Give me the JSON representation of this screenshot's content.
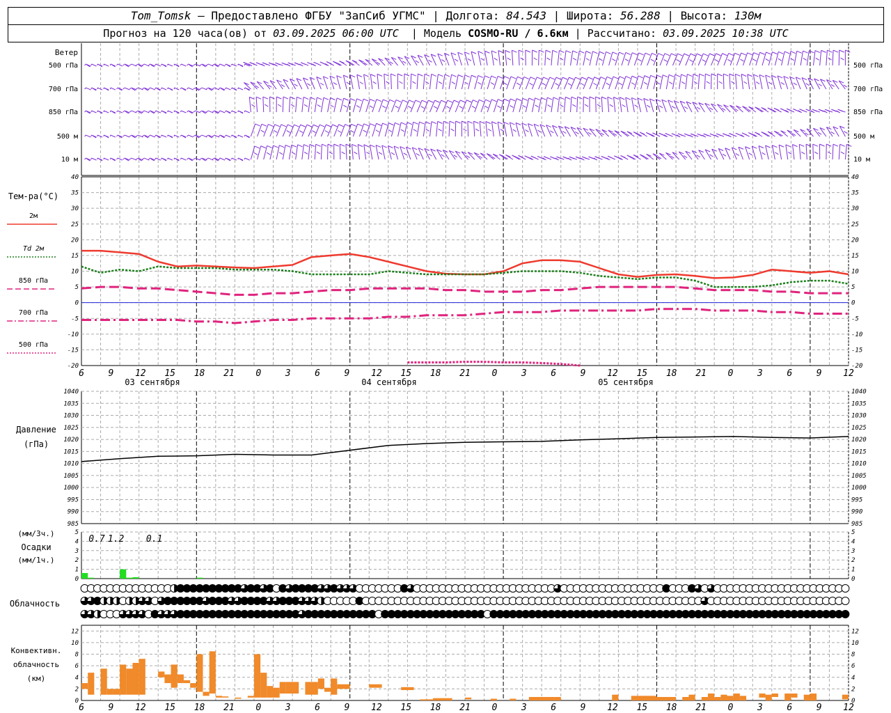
{
  "header": {
    "station": "Tom_Tomsk",
    "provider": "– Предоставлено ФГБУ \"ЗапСиб УГМС\"",
    "lon_label": "Долгота:",
    "lon_value": "84.543",
    "lat_label": "Широта:",
    "lat_value": "56.288",
    "alt_label": "Высота:",
    "alt_value": "130м",
    "forecast_label": "Прогноз на 120 часа(ов) от",
    "forecast_time": "03.09.2025 06:00 UTC",
    "model_label": "Модель",
    "model_value": "COSMO-RU / 6.6км",
    "calc_label": "Рассчитано:",
    "calc_time": "03.09.2025 10:38 UTC"
  },
  "panels": {
    "wind": {
      "title": "Ветер",
      "levels": [
        "500 гПа",
        "700 гПа",
        "850 гПа",
        "500 м",
        "10 м"
      ],
      "barb_color": "#7f2fd8"
    },
    "temp": {
      "title": "Тем-ра(°C)",
      "legend": [
        {
          "label": "2м",
          "color": "#ef3a2e",
          "style": "solid"
        },
        {
          "label": "Td  2м",
          "color": "#1b7f1b",
          "style": "dotted"
        },
        {
          "label": "850 гПа",
          "color": "#e0237e",
          "style": "dashed"
        },
        {
          "label": "700 гПа",
          "color": "#e0237e",
          "style": "dashdot"
        },
        {
          "label": "500 гПа",
          "color": "#e0237e",
          "style": "dotted"
        }
      ],
      "y_ticks": [
        40,
        35,
        30,
        25,
        20,
        15,
        10,
        5,
        0,
        -5,
        -10,
        -15,
        -20
      ],
      "zero_line_color": "#2222dd"
    },
    "pressure": {
      "title": "Давление",
      "unit": "(гПа)",
      "y_ticks": [
        1040,
        1035,
        1030,
        1025,
        1020,
        1015,
        1010,
        1005,
        1000,
        995,
        990,
        985
      ]
    },
    "precip": {
      "unit_3h": "(мм/3ч.)",
      "title": "Осадки",
      "unit_1h": "(мм/1ч.)",
      "y_ticks": [
        5,
        4,
        3,
        2,
        1,
        0
      ],
      "totals": [
        {
          "hour": 6,
          "text": "0.7"
        },
        {
          "hour": 9,
          "text": "1.2"
        },
        {
          "hour": 15,
          "text": "0.1"
        }
      ],
      "bar_color": "#22dd22"
    },
    "cloud": {
      "title": "Облачность"
    },
    "conv": {
      "title": "Конвективн.",
      "title2": "облачность",
      "unit": "(км)",
      "y_ticks": [
        12,
        10,
        8,
        6,
        4,
        2,
        0
      ],
      "bar_color": "#f08a2a"
    }
  },
  "time_axis": {
    "hour_labels": [
      "6",
      "9",
      "12",
      "15",
      "18",
      "21",
      "0",
      "3",
      "6",
      "9",
      "12",
      "15",
      "18",
      "21",
      "0",
      "3",
      "6",
      "9",
      "12",
      "15",
      "18",
      "21",
      "0",
      "3",
      "6",
      "9",
      "12"
    ],
    "day_labels": [
      "03 сентября",
      "04 сентября",
      "05 сентября"
    ]
  },
  "chart_data": [
    {
      "type": "line",
      "title": "Тем-ра(°C)",
      "x_hours_from_start": [
        0,
        3,
        6,
        9,
        12,
        15,
        18,
        21,
        24,
        27,
        30,
        33,
        36,
        39,
        42,
        45,
        48,
        51,
        54,
        57,
        60,
        63,
        66,
        69,
        72,
        75,
        78,
        81,
        84,
        87,
        90,
        93,
        96,
        99,
        102,
        105,
        108,
        111,
        114,
        117,
        120
      ],
      "ylim": [
        -20,
        40
      ],
      "series": [
        {
          "name": "2м",
          "values": [
            16.5,
            16.5,
            16.0,
            15.5,
            13.0,
            11.5,
            11.8,
            11.5,
            11.2,
            11.0,
            11.5,
            12.0,
            14.5,
            15.0,
            15.5,
            14.5,
            13.0,
            11.5,
            10.0,
            9.2,
            9.0,
            9.0,
            10.0,
            12.5,
            13.5,
            13.5,
            13.0,
            11.0,
            9.0,
            8.2,
            8.8,
            9.0,
            8.5,
            7.8,
            8.0,
            8.8,
            10.5,
            10.0,
            9.5,
            10.0,
            9.0
          ]
        },
        {
          "name": "Td  2м",
          "values": [
            11.5,
            9.5,
            10.5,
            10.0,
            11.5,
            11.0,
            11.0,
            11.0,
            10.5,
            10.5,
            10.5,
            10.0,
            9.0,
            9.0,
            9.0,
            9.0,
            10.0,
            9.5,
            9.0,
            9.0,
            9.0,
            9.0,
            9.5,
            10.0,
            10.0,
            10.0,
            9.5,
            8.5,
            8.0,
            7.5,
            8.0,
            8.0,
            7.0,
            5.0,
            5.0,
            5.0,
            5.5,
            6.5,
            7.0,
            7.0,
            6.0
          ]
        },
        {
          "name": "850 гПа",
          "values": [
            4.5,
            5.0,
            5.0,
            4.5,
            4.5,
            4.0,
            3.5,
            3.0,
            2.5,
            2.5,
            3.0,
            3.0,
            3.5,
            4.0,
            4.0,
            4.5,
            4.5,
            4.5,
            4.5,
            4.0,
            4.0,
            3.5,
            3.5,
            3.5,
            4.0,
            4.0,
            4.5,
            5.0,
            5.0,
            5.0,
            5.0,
            5.0,
            4.5,
            4.0,
            4.0,
            4.0,
            3.5,
            3.5,
            3.0,
            3.0,
            3.0
          ]
        },
        {
          "name": "700 гПа",
          "values": [
            -5.5,
            -5.5,
            -5.5,
            -5.5,
            -5.5,
            -5.5,
            -6.0,
            -6.0,
            -6.5,
            -6.0,
            -5.5,
            -5.5,
            -5.0,
            -5.0,
            -5.0,
            -5.0,
            -4.5,
            -4.5,
            -4.0,
            -4.0,
            -4.0,
            -3.5,
            -3.0,
            -3.0,
            -3.0,
            -2.5,
            -2.5,
            -2.5,
            -2.5,
            -2.5,
            -2.0,
            -2.0,
            -2.0,
            -2.5,
            -2.5,
            -2.5,
            -3.0,
            -3.0,
            -3.5,
            -3.5,
            -3.5
          ]
        },
        {
          "name": "500 гПа",
          "values": [
            null,
            null,
            null,
            null,
            null,
            null,
            null,
            null,
            null,
            null,
            null,
            null,
            null,
            null,
            null,
            null,
            null,
            -19.0,
            -19.0,
            -19.0,
            -18.8,
            -18.8,
            -19.0,
            -19.0,
            -19.2,
            -19.5,
            -20.0,
            null,
            null,
            null,
            null,
            null,
            null,
            null,
            null,
            null,
            null,
            null,
            null,
            null,
            null
          ]
        }
      ]
    },
    {
      "type": "line",
      "title": "Давление",
      "x_hours_from_start": [
        0,
        6,
        12,
        18,
        24,
        30,
        36,
        42,
        48,
        54,
        60,
        66,
        72,
        78,
        84,
        90,
        96,
        102,
        108,
        114,
        120
      ],
      "ylim": [
        985,
        1040
      ],
      "series": [
        {
          "name": "Давление",
          "values": [
            1010.8,
            1012.0,
            1013.0,
            1013.2,
            1013.8,
            1013.5,
            1013.5,
            1015.5,
            1017.5,
            1018.3,
            1018.8,
            1019.0,
            1019.2,
            1019.8,
            1020.3,
            1020.8,
            1021.0,
            1021.2,
            1020.8,
            1020.6,
            1021.2
          ]
        }
      ]
    },
    {
      "type": "bar",
      "title": "Осадки",
      "x_hours_from_start": [
        0,
        1,
        2,
        3,
        4,
        5,
        6,
        7,
        8,
        9,
        10,
        11,
        12,
        13,
        14,
        15,
        16,
        17,
        18,
        19,
        20,
        21,
        22,
        23,
        24
      ],
      "ylim": [
        0,
        5
      ],
      "values": [
        0.6,
        0.1,
        0.0,
        0.0,
        0.0,
        0.0,
        1.0,
        0.1,
        0.15,
        0.0,
        0.0,
        0.0,
        0.0,
        0.0,
        0.0,
        0.0,
        0.0,
        0.0,
        0.1,
        0.0,
        0.0,
        0.0,
        0.0,
        0.0,
        0.0
      ]
    },
    {
      "type": "bar",
      "title": "Конвективн. облачность",
      "ylim": [
        0,
        13
      ],
      "segments": [
        {
          "h0": 0,
          "h1": 1,
          "bottom": 2,
          "top": 3
        },
        {
          "h0": 1,
          "h1": 2,
          "bottom": 1,
          "top": 4.8
        },
        {
          "h0": 3,
          "h1": 4,
          "bottom": 1,
          "top": 5.5
        },
        {
          "h0": 4,
          "h1": 5,
          "bottom": 1,
          "top": 2
        },
        {
          "h0": 5,
          "h1": 6,
          "bottom": 1,
          "top": 2
        },
        {
          "h0": 6,
          "h1": 7,
          "bottom": 1,
          "top": 6.2
        },
        {
          "h0": 7,
          "h1": 8,
          "bottom": 1,
          "top": 5.5
        },
        {
          "h0": 8,
          "h1": 9,
          "bottom": 1,
          "top": 6.5
        },
        {
          "h0": 9,
          "h1": 10,
          "bottom": 1,
          "top": 7.2
        },
        {
          "h0": 12,
          "h1": 13,
          "bottom": 4,
          "top": 5
        },
        {
          "h0": 13,
          "h1": 14,
          "bottom": 3,
          "top": 4.5
        },
        {
          "h0": 14,
          "h1": 15,
          "bottom": 2.2,
          "top": 6.2
        },
        {
          "h0": 15,
          "h1": 16,
          "bottom": 3,
          "top": 4.5
        },
        {
          "h0": 16,
          "h1": 17,
          "bottom": 3,
          "top": 3.5
        },
        {
          "h0": 17,
          "h1": 18,
          "bottom": 2.2,
          "top": 3
        },
        {
          "h0": 18,
          "h1": 19,
          "bottom": 1.5,
          "top": 8
        },
        {
          "h0": 19,
          "h1": 20,
          "bottom": 0.8,
          "top": 1.5
        },
        {
          "h0": 20,
          "h1": 21,
          "bottom": 1.2,
          "top": 8.5
        },
        {
          "h0": 21,
          "h1": 22,
          "bottom": 0.5,
          "top": 0.8
        },
        {
          "h0": 22,
          "h1": 23,
          "bottom": 0.5,
          "top": 0.7
        },
        {
          "h0": 24,
          "h1": 25,
          "bottom": 0.3,
          "top": 0.5
        },
        {
          "h0": 26,
          "h1": 27,
          "bottom": 0.5,
          "top": 0.8
        },
        {
          "h0": 27,
          "h1": 28,
          "bottom": 0.5,
          "top": 8
        },
        {
          "h0": 28,
          "h1": 29,
          "bottom": 0.5,
          "top": 4.8
        },
        {
          "h0": 29,
          "h1": 30,
          "bottom": 0.5,
          "top": 2.5
        },
        {
          "h0": 30,
          "h1": 31,
          "bottom": 0.5,
          "top": 2.2
        },
        {
          "h0": 31,
          "h1": 32,
          "bottom": 1.2,
          "top": 3.2
        },
        {
          "h0": 32,
          "h1": 34,
          "bottom": 1.2,
          "top": 3.2
        },
        {
          "h0": 35,
          "h1": 37,
          "bottom": 1,
          "top": 3.2
        },
        {
          "h0": 37,
          "h1": 38,
          "bottom": 2,
          "top": 3.8
        },
        {
          "h0": 38,
          "h1": 39,
          "bottom": 1.5,
          "top": 2.2
        },
        {
          "h0": 39,
          "h1": 40,
          "bottom": 1,
          "top": 3.8
        },
        {
          "h0": 40,
          "h1": 42,
          "bottom": 2,
          "top": 2.8
        },
        {
          "h0": 45,
          "h1": 47,
          "bottom": 2.2,
          "top": 2.8
        },
        {
          "h0": 50,
          "h1": 52,
          "bottom": 1.8,
          "top": 2.3
        },
        {
          "h0": 53,
          "h1": 55,
          "bottom": 0,
          "top": 0.2
        },
        {
          "h0": 55,
          "h1": 58,
          "bottom": 0,
          "top": 0.4
        },
        {
          "h0": 60,
          "h1": 61,
          "bottom": 0.2,
          "top": 0.5
        },
        {
          "h0": 64,
          "h1": 65,
          "bottom": 0,
          "top": 0.3
        },
        {
          "h0": 67,
          "h1": 68,
          "bottom": 0,
          "top": 0.3
        },
        {
          "h0": 70,
          "h1": 74,
          "bottom": 0,
          "top": 0.6
        },
        {
          "h0": 74,
          "h1": 75,
          "bottom": 0,
          "top": 0.6
        },
        {
          "h0": 83,
          "h1": 84,
          "bottom": 0,
          "top": 1
        },
        {
          "h0": 86,
          "h1": 90,
          "bottom": 0,
          "top": 0.8
        },
        {
          "h0": 90,
          "h1": 93,
          "bottom": 0,
          "top": 0.6
        },
        {
          "h0": 94,
          "h1": 95,
          "bottom": 0,
          "top": 0.6
        },
        {
          "h0": 95,
          "h1": 96,
          "bottom": 0,
          "top": 1
        },
        {
          "h0": 97,
          "h1": 98,
          "bottom": 0,
          "top": 0.6
        },
        {
          "h0": 98,
          "h1": 99,
          "bottom": 0,
          "top": 1.2
        },
        {
          "h0": 99,
          "h1": 100,
          "bottom": 0,
          "top": 0.6
        },
        {
          "h0": 100,
          "h1": 101,
          "bottom": 0,
          "top": 1
        },
        {
          "h0": 101,
          "h1": 102,
          "bottom": 0,
          "top": 0.8
        },
        {
          "h0": 102,
          "h1": 103,
          "bottom": 0,
          "top": 1.2
        },
        {
          "h0": 103,
          "h1": 104,
          "bottom": 0,
          "top": 0.8
        },
        {
          "h0": 106,
          "h1": 107,
          "bottom": 0.5,
          "top": 1.2
        },
        {
          "h0": 107,
          "h1": 108,
          "bottom": 0,
          "top": 1
        },
        {
          "h0": 108,
          "h1": 109,
          "bottom": 0.6,
          "top": 1.2
        },
        {
          "h0": 110,
          "h1": 111,
          "bottom": 0,
          "top": 1.2
        },
        {
          "h0": 111,
          "h1": 112,
          "bottom": 0.5,
          "top": 1.2
        },
        {
          "h0": 113,
          "h1": 114,
          "bottom": 0,
          "top": 1
        },
        {
          "h0": 114,
          "h1": 115,
          "bottom": 0,
          "top": 1.2
        },
        {
          "h0": 119,
          "h1": 120,
          "bottom": 0.2,
          "top": 1
        }
      ]
    }
  ],
  "cloud_rows": [
    "000000000000002444444444434434043444433433300000004300000000000000000000003000000000000000040004303000000000000000000000",
    "334222022330344444434443344443344433320000040000000000000000000000000000000000000000000000000000030000000000000000000000",
    "332000333304333444444444444444444434444444444404444444444444444044444444444444444444444444444444444444444444444444444444"
  ]
}
